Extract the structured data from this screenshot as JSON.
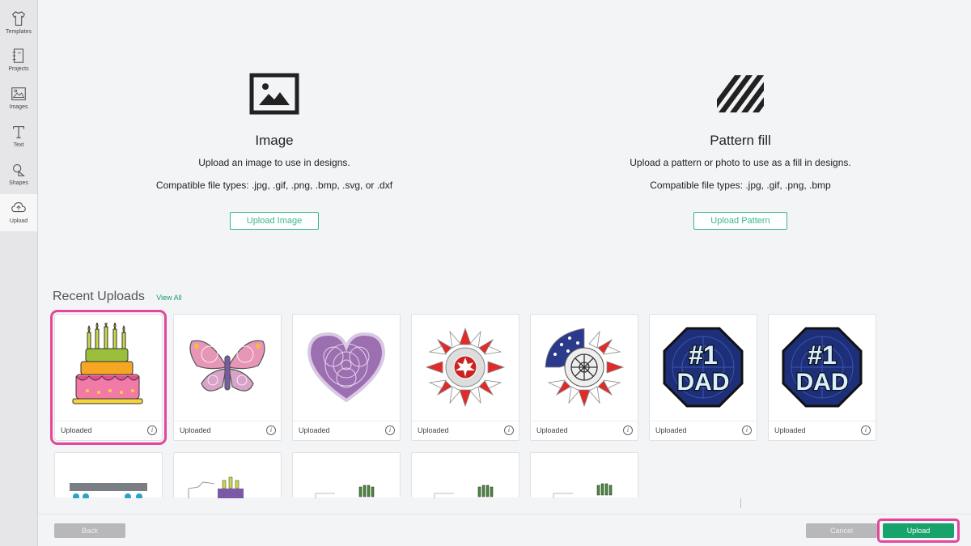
{
  "sidebar": {
    "items": [
      {
        "label": "Templates",
        "icon": "shirt-icon"
      },
      {
        "label": "Projects",
        "icon": "notebook-icon"
      },
      {
        "label": "Images",
        "icon": "picture-icon"
      },
      {
        "label": "Text",
        "icon": "text-icon"
      },
      {
        "label": "Shapes",
        "icon": "shapes-icon"
      },
      {
        "label": "Upload",
        "icon": "cloud-upload-icon",
        "active": true
      }
    ]
  },
  "image_option": {
    "title": "Image",
    "description": "Upload an image to use in designs.",
    "types": "Compatible file types: .jpg, .gif, .png, .bmp, .svg, or .dxf",
    "button": "Upload Image"
  },
  "pattern_option": {
    "title": "Pattern fill",
    "description": "Upload a pattern or photo to use as a fill in designs.",
    "types": "Compatible file types: .jpg, .gif, .png, .bmp",
    "button": "Upload Pattern"
  },
  "recent": {
    "title": "Recent Uploads",
    "view_all": "View All",
    "uploads": [
      {
        "thumb": "birthday-cake",
        "status": "Uploaded",
        "selected": true
      },
      {
        "thumb": "mandala-butterfly",
        "status": "Uploaded"
      },
      {
        "thumb": "mandala-heart",
        "status": "Uploaded"
      },
      {
        "thumb": "red-white-sunflower",
        "status": "Uploaded"
      },
      {
        "thumb": "flag-sunflower",
        "status": "Uploaded"
      },
      {
        "thumb": "number-one-dad",
        "status": "Uploaded"
      },
      {
        "thumb": "number-one-dad",
        "status": "Uploaded"
      }
    ],
    "more_uploads": [
      {
        "thumb": "partial-border"
      },
      {
        "thumb": "partial-cake"
      },
      {
        "thumb": "partial-candles"
      },
      {
        "thumb": "partial-candles"
      },
      {
        "thumb": "partial-candles"
      }
    ],
    "dad_text": [
      "#1",
      "DAD"
    ]
  },
  "footer": {
    "back": "Back",
    "cancel": "Cancel",
    "upload": "Upload"
  },
  "colors": {
    "accent": "#17a36b",
    "outline_accent": "#3bb58f",
    "highlight": "#e2479b"
  }
}
